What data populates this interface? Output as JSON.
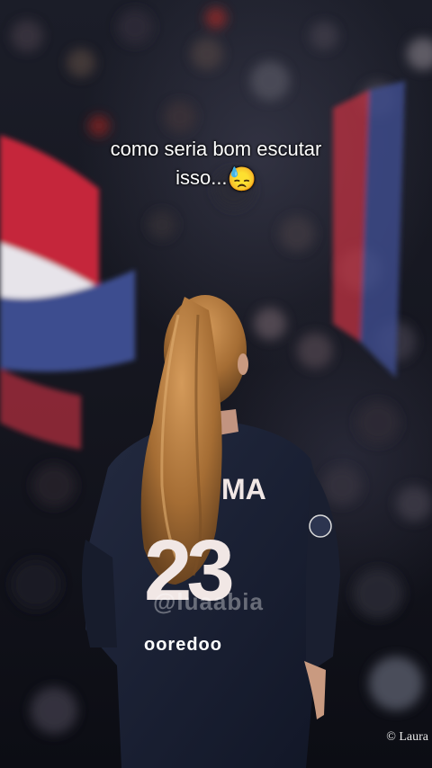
{
  "caption": {
    "line1": "como seria bom escutar",
    "line2": "isso...",
    "emoji": "😓"
  },
  "jersey": {
    "name_fragment": "MA",
    "number": "23",
    "sponsor": "ooredoo"
  },
  "watermark": "@luaabia",
  "photo_credit": "© Laura",
  "colors": {
    "jersey": "#1a2238",
    "hair": "#b0793d",
    "flag_red": "#c5253a",
    "flag_blue": "#3d4e8f"
  }
}
